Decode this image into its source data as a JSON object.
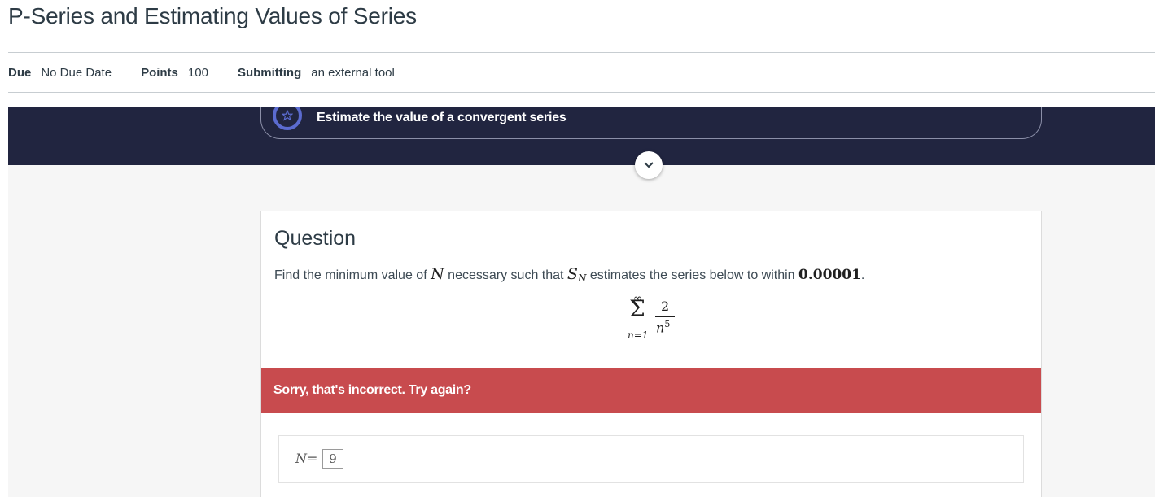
{
  "assignment": {
    "title": "P-Series and Estimating Values of Series",
    "meta": [
      {
        "label": "Due",
        "value": "No Due Date"
      },
      {
        "label": "Points",
        "value": "100"
      },
      {
        "label": "Submitting",
        "value": "an external tool"
      }
    ]
  },
  "tool": {
    "objective": "Estimate the value of a convergent series",
    "objective_icon": "star-icon",
    "toggle_icon": "chevron-down-icon",
    "colors": {
      "banner": "#212540",
      "accent": "#5b6bd0",
      "error": "#c84b4e"
    }
  },
  "question": {
    "heading": "Question",
    "prompt_before_N": "Find the minimum value of",
    "var_N": "N",
    "prompt_middle": "necessary such that",
    "var_S": "S",
    "var_S_sub": "N",
    "prompt_after": "estimates the series below to within",
    "tolerance": "0.00001",
    "period": ".",
    "series": {
      "upper": "∞",
      "sigma": "Σ",
      "lower": "n=1",
      "numerator": "2",
      "denominator_base": "n",
      "denominator_exp": "5"
    }
  },
  "feedback": {
    "message": "Sorry, that's incorrect. Try again?"
  },
  "answer": {
    "label_var": "N",
    "label_eq": "=",
    "value": "9"
  }
}
